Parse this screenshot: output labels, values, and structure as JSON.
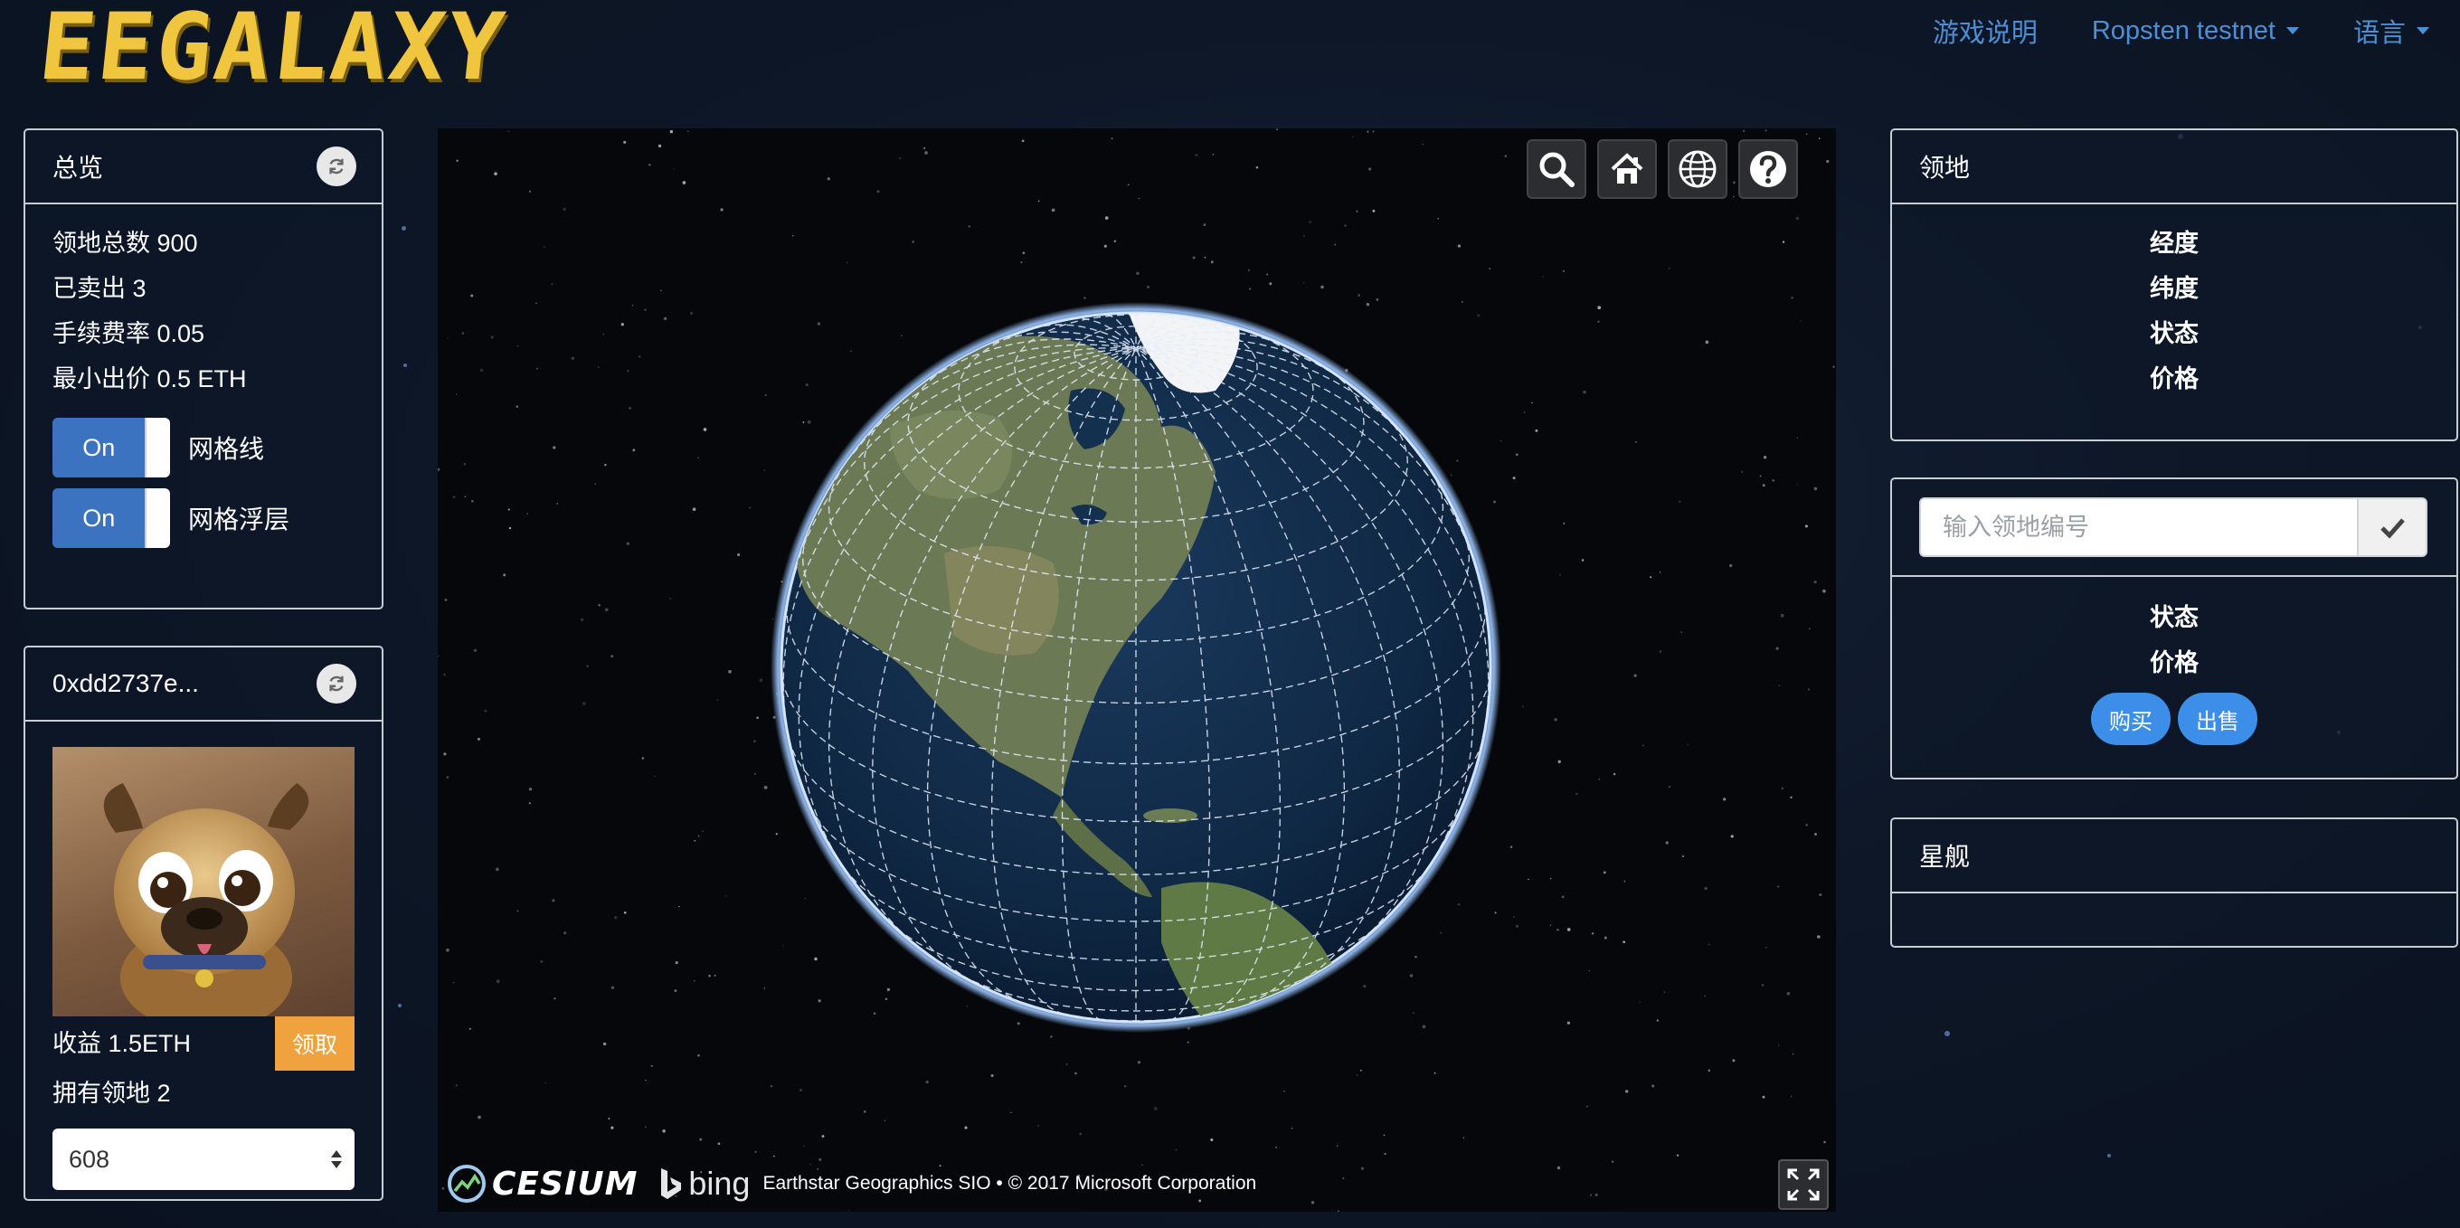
{
  "header": {
    "logo_text": "EEGALAXY",
    "nav": {
      "game_guide": "游戏说明",
      "network": "Ropsten testnet",
      "language": "语言"
    }
  },
  "overview": {
    "title": "总览",
    "total_lands": "领地总数 900",
    "sold": "已卖出 3",
    "fee_rate": "手续费率 0.05",
    "min_bid": "最小出价 0.5 ETH",
    "gridline_toggle": {
      "state": "On",
      "label": "网格线"
    },
    "overlay_toggle": {
      "state": "On",
      "label": "网格浮层"
    }
  },
  "account": {
    "address": "0xdd2737e...",
    "income": "收益 1.5ETH",
    "claim_label": "领取",
    "lands_owned": "拥有领地 2",
    "selected_land": "608"
  },
  "territory": {
    "title": "领地",
    "fields": [
      "经度",
      "纬度",
      "状态",
      "价格"
    ]
  },
  "land_lookup": {
    "placeholder": "输入领地编号",
    "fields": [
      "状态",
      "价格"
    ],
    "buy_label": "购买",
    "sell_label": "出售"
  },
  "starship": {
    "title": "星舰"
  },
  "viewer": {
    "cesium_text": "CESIUM",
    "bing_text": "bing",
    "attribution": "Earthstar Geographics SIO • © 2017 Microsoft Corporation",
    "tools": [
      "search-icon",
      "home-icon",
      "globe-icon",
      "help-icon"
    ]
  },
  "colors": {
    "accent_blue": "#3c8ee8",
    "toggle_blue": "#3c73c0",
    "claim_orange": "#f0a23e",
    "logo_gold": "#f0c63e",
    "nav_link": "#4d8fd6"
  }
}
